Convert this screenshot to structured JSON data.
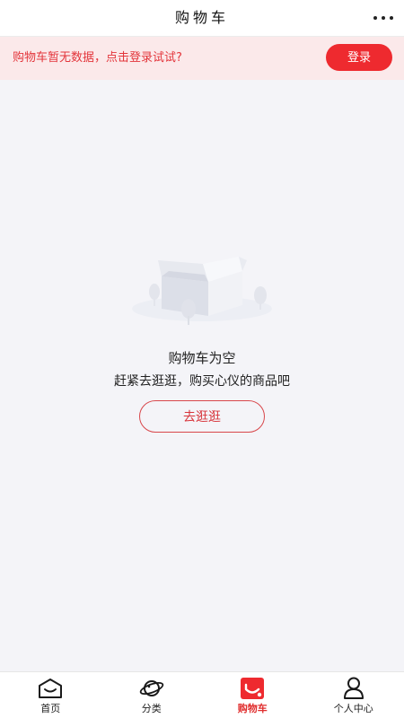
{
  "header": {
    "title": "购物车",
    "more_icon": "more-dots-icon"
  },
  "login_banner": {
    "tip": "购物车暂无数据，点击登录试试?",
    "button_label": "登录",
    "accent_color": "#ee2a2f"
  },
  "empty_state": {
    "illustration_icon": "empty-box-icon",
    "title": "购物车为空",
    "description": "赶紧去逛逛，购买心仪的商品吧",
    "button_label": "去逛逛"
  },
  "tabbar": {
    "active_tab": "购物车",
    "items": [
      {
        "label": "首页",
        "icon": "home-icon"
      },
      {
        "label": "分类",
        "icon": "planet-icon"
      },
      {
        "label": "购物车",
        "icon": "cart-icon"
      },
      {
        "label": "个人中心",
        "icon": "user-icon"
      }
    ]
  }
}
